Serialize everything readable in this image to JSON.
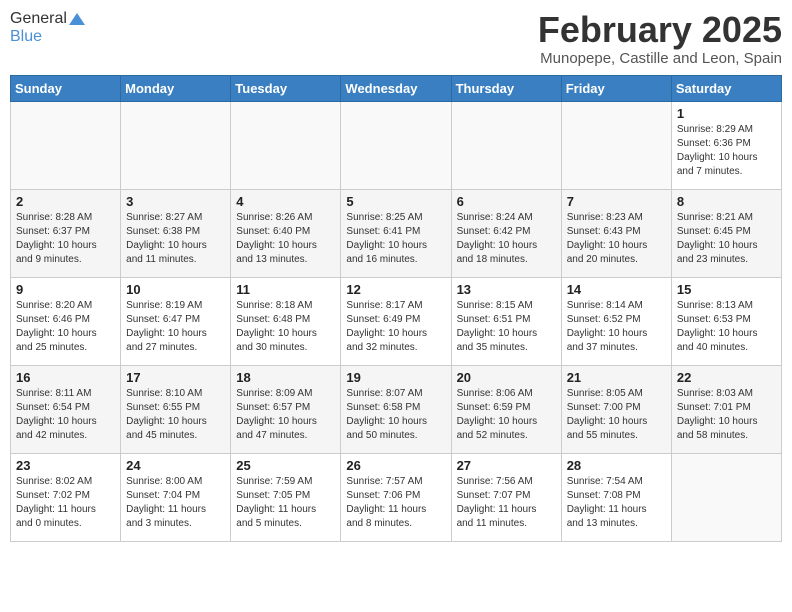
{
  "header": {
    "logo_general": "General",
    "logo_blue": "Blue",
    "month_year": "February 2025",
    "location": "Munopepe, Castille and Leon, Spain"
  },
  "days_of_week": [
    "Sunday",
    "Monday",
    "Tuesday",
    "Wednesday",
    "Thursday",
    "Friday",
    "Saturday"
  ],
  "weeks": [
    [
      {
        "day": "",
        "info": ""
      },
      {
        "day": "",
        "info": ""
      },
      {
        "day": "",
        "info": ""
      },
      {
        "day": "",
        "info": ""
      },
      {
        "day": "",
        "info": ""
      },
      {
        "day": "",
        "info": ""
      },
      {
        "day": "1",
        "info": "Sunrise: 8:29 AM\nSunset: 6:36 PM\nDaylight: 10 hours\nand 7 minutes."
      }
    ],
    [
      {
        "day": "2",
        "info": "Sunrise: 8:28 AM\nSunset: 6:37 PM\nDaylight: 10 hours\nand 9 minutes."
      },
      {
        "day": "3",
        "info": "Sunrise: 8:27 AM\nSunset: 6:38 PM\nDaylight: 10 hours\nand 11 minutes."
      },
      {
        "day": "4",
        "info": "Sunrise: 8:26 AM\nSunset: 6:40 PM\nDaylight: 10 hours\nand 13 minutes."
      },
      {
        "day": "5",
        "info": "Sunrise: 8:25 AM\nSunset: 6:41 PM\nDaylight: 10 hours\nand 16 minutes."
      },
      {
        "day": "6",
        "info": "Sunrise: 8:24 AM\nSunset: 6:42 PM\nDaylight: 10 hours\nand 18 minutes."
      },
      {
        "day": "7",
        "info": "Sunrise: 8:23 AM\nSunset: 6:43 PM\nDaylight: 10 hours\nand 20 minutes."
      },
      {
        "day": "8",
        "info": "Sunrise: 8:21 AM\nSunset: 6:45 PM\nDaylight: 10 hours\nand 23 minutes."
      }
    ],
    [
      {
        "day": "9",
        "info": "Sunrise: 8:20 AM\nSunset: 6:46 PM\nDaylight: 10 hours\nand 25 minutes."
      },
      {
        "day": "10",
        "info": "Sunrise: 8:19 AM\nSunset: 6:47 PM\nDaylight: 10 hours\nand 27 minutes."
      },
      {
        "day": "11",
        "info": "Sunrise: 8:18 AM\nSunset: 6:48 PM\nDaylight: 10 hours\nand 30 minutes."
      },
      {
        "day": "12",
        "info": "Sunrise: 8:17 AM\nSunset: 6:49 PM\nDaylight: 10 hours\nand 32 minutes."
      },
      {
        "day": "13",
        "info": "Sunrise: 8:15 AM\nSunset: 6:51 PM\nDaylight: 10 hours\nand 35 minutes."
      },
      {
        "day": "14",
        "info": "Sunrise: 8:14 AM\nSunset: 6:52 PM\nDaylight: 10 hours\nand 37 minutes."
      },
      {
        "day": "15",
        "info": "Sunrise: 8:13 AM\nSunset: 6:53 PM\nDaylight: 10 hours\nand 40 minutes."
      }
    ],
    [
      {
        "day": "16",
        "info": "Sunrise: 8:11 AM\nSunset: 6:54 PM\nDaylight: 10 hours\nand 42 minutes."
      },
      {
        "day": "17",
        "info": "Sunrise: 8:10 AM\nSunset: 6:55 PM\nDaylight: 10 hours\nand 45 minutes."
      },
      {
        "day": "18",
        "info": "Sunrise: 8:09 AM\nSunset: 6:57 PM\nDaylight: 10 hours\nand 47 minutes."
      },
      {
        "day": "19",
        "info": "Sunrise: 8:07 AM\nSunset: 6:58 PM\nDaylight: 10 hours\nand 50 minutes."
      },
      {
        "day": "20",
        "info": "Sunrise: 8:06 AM\nSunset: 6:59 PM\nDaylight: 10 hours\nand 52 minutes."
      },
      {
        "day": "21",
        "info": "Sunrise: 8:05 AM\nSunset: 7:00 PM\nDaylight: 10 hours\nand 55 minutes."
      },
      {
        "day": "22",
        "info": "Sunrise: 8:03 AM\nSunset: 7:01 PM\nDaylight: 10 hours\nand 58 minutes."
      }
    ],
    [
      {
        "day": "23",
        "info": "Sunrise: 8:02 AM\nSunset: 7:02 PM\nDaylight: 11 hours\nand 0 minutes."
      },
      {
        "day": "24",
        "info": "Sunrise: 8:00 AM\nSunset: 7:04 PM\nDaylight: 11 hours\nand 3 minutes."
      },
      {
        "day": "25",
        "info": "Sunrise: 7:59 AM\nSunset: 7:05 PM\nDaylight: 11 hours\nand 5 minutes."
      },
      {
        "day": "26",
        "info": "Sunrise: 7:57 AM\nSunset: 7:06 PM\nDaylight: 11 hours\nand 8 minutes."
      },
      {
        "day": "27",
        "info": "Sunrise: 7:56 AM\nSunset: 7:07 PM\nDaylight: 11 hours\nand 11 minutes."
      },
      {
        "day": "28",
        "info": "Sunrise: 7:54 AM\nSunset: 7:08 PM\nDaylight: 11 hours\nand 13 minutes."
      },
      {
        "day": "",
        "info": ""
      }
    ]
  ]
}
